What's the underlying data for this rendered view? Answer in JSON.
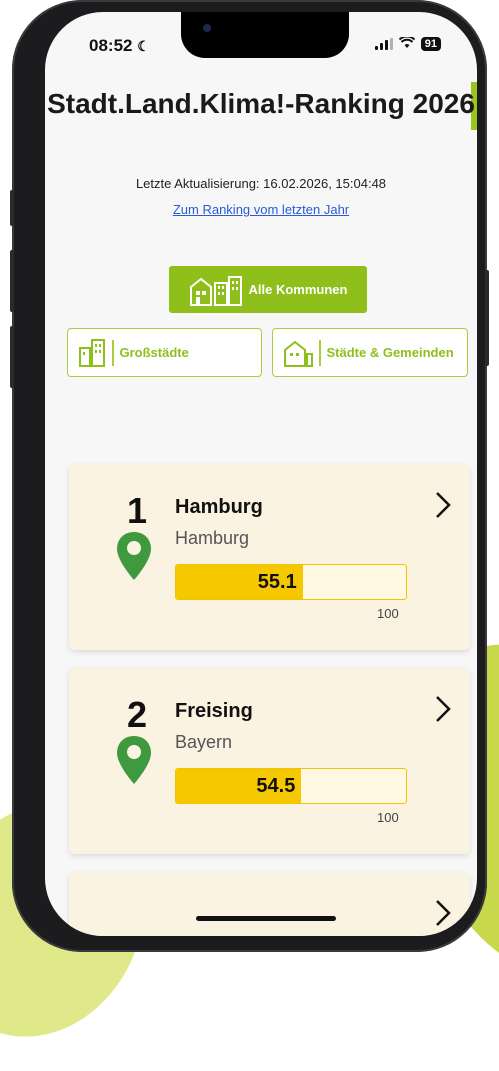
{
  "status": {
    "time": "08:52",
    "battery": "91"
  },
  "header": {
    "title": "Stadt.Land.Klima!-Ranking 2026",
    "updated": "Letzte Aktualisierung: 16.02.2026, 15:04:48",
    "last_year_link": "Zum Ranking vom letzten Jahr"
  },
  "filters": {
    "all": "Alle Kommunen",
    "large": "Großstädte",
    "small": "Städte & Gemeinden"
  },
  "rankings": [
    {
      "rank": "1",
      "city": "Hamburg",
      "state": "Hamburg",
      "score": "55.1",
      "score_value": 55.1,
      "max": "100"
    },
    {
      "rank": "2",
      "city": "Freising",
      "state": "Bayern",
      "score": "54.5",
      "score_value": 54.5,
      "max": "100"
    }
  ],
  "colors": {
    "accent_green": "#8fbf1a",
    "bar_yellow": "#f5c800",
    "pin_green": "#3f9a3f",
    "card_bg": "#fbf3e2"
  }
}
